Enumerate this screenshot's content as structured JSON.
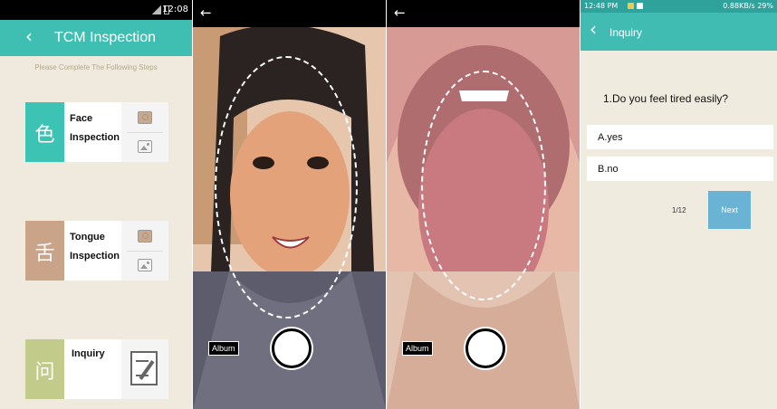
{
  "panel1": {
    "status_time": "12:08",
    "title": "TCM Inspection",
    "steps_hint": "Please Complete The Following Steps",
    "cards": [
      {
        "label_line1": "Face",
        "label_line2": "Inspection",
        "glyph": "色",
        "color": "#3cc3b4"
      },
      {
        "label_line1": "Tongue",
        "label_line2": "Inspection",
        "glyph": "舌",
        "color": "#c9a489"
      },
      {
        "label_line1": "Inquiry",
        "label_line2": "",
        "glyph": "问",
        "color": "#c3cb8a"
      }
    ],
    "icons": {
      "back": "chevron-left-icon",
      "camera": "camera-icon",
      "gallery": "image-icon",
      "note": "note-edit-icon"
    }
  },
  "face_camera": {
    "album_label": "Album",
    "back_icon": "arrow-left-icon"
  },
  "tongue_camera": {
    "album_label": "Album",
    "back_icon": "arrow-left-icon"
  },
  "inquiry": {
    "status_time": "12:48 PM",
    "status_right": "0.88KB/s  29%",
    "title": "Inquiry",
    "question": "1.Do you feel tired easily?",
    "options": [
      "A.yes",
      "B.no"
    ],
    "pager": "1/12",
    "next_label": "Next"
  },
  "colors": {
    "teal": "#3fbfb2",
    "accent_blue": "#6ab3d4",
    "background": "#efe9de"
  }
}
